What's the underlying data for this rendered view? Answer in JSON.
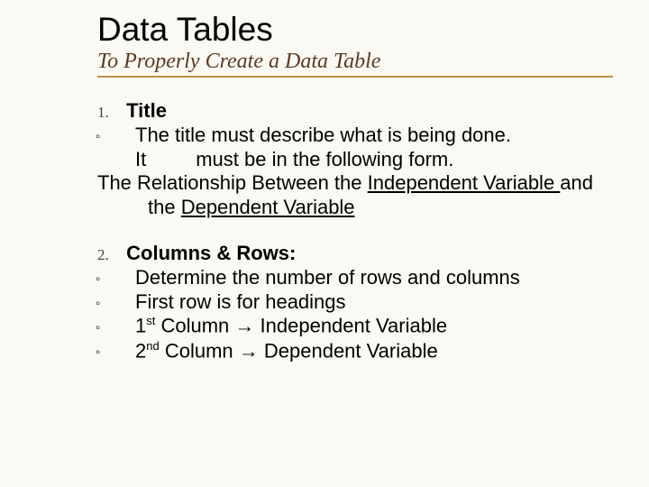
{
  "title": "Data Tables",
  "subtitle": "To Properly Create a Data Table",
  "item1": {
    "num": "1.",
    "heading": "Title",
    "bullet": "◦",
    "desc": "The title must describe what is being done.  It         must be in the following form.",
    "tmpl_pre": "The Relationship Between the ",
    "tmpl_iv": "Independent Variable ",
    "tmpl_mid": "and the ",
    "tmpl_dv": "Dependent Variable"
  },
  "item2": {
    "num": "2.",
    "heading": "Columns & Rows:",
    "bullet": "◦",
    "b1": "Determine the number of rows and columns",
    "b2": "First row is for headings",
    "b3a": "1",
    "b3sup": "st",
    "b3b": " Column ",
    "arrow": "→",
    "b3c": " Independent Variable",
    "b4a": "2",
    "b4sup": "nd",
    "b4b": " Column ",
    "b4c": " Dependent Variable"
  }
}
